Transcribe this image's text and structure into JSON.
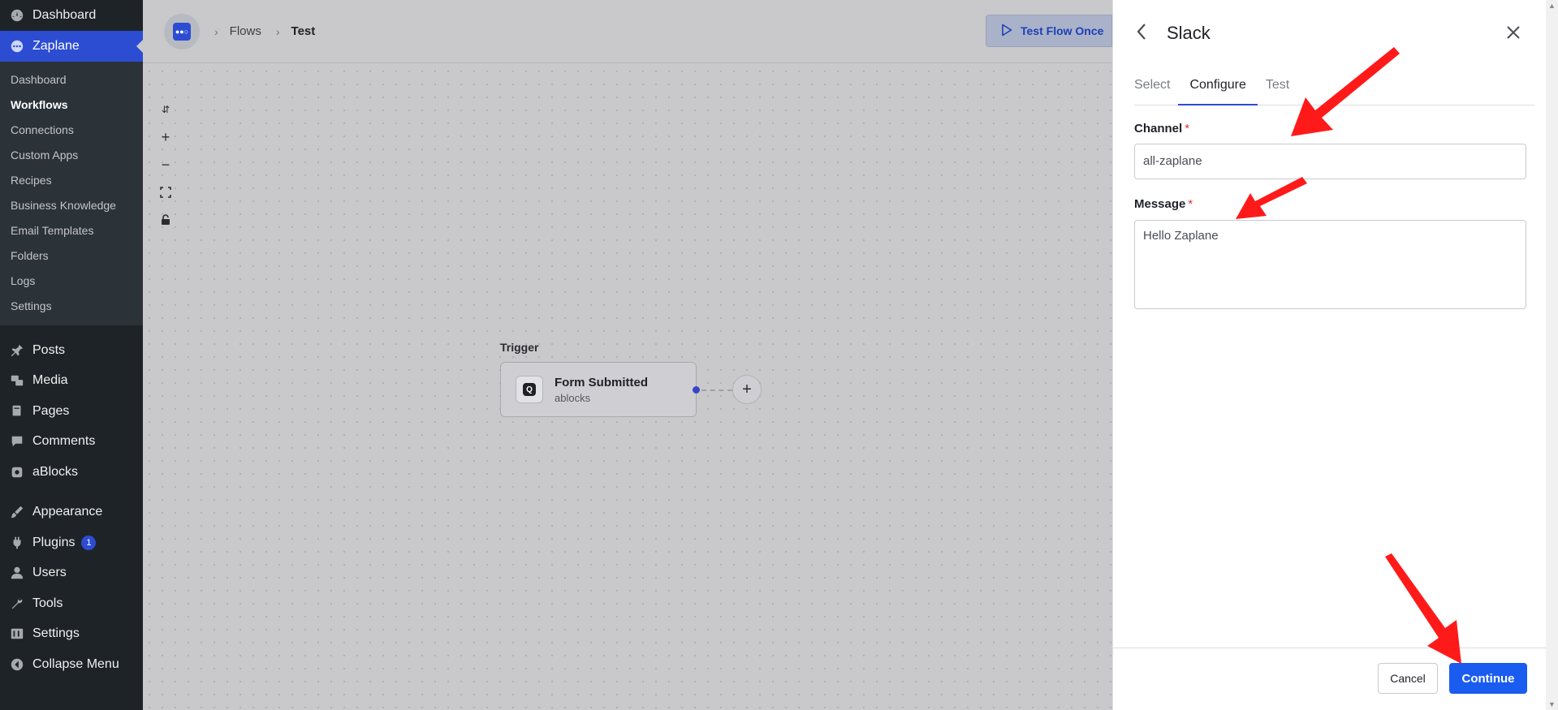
{
  "wp_sidebar": {
    "top_item": "Dashboard",
    "active_item": "Zaplane",
    "submenu": [
      "Dashboard",
      "Workflows",
      "Connections",
      "Custom Apps",
      "Recipes",
      "Business Knowledge",
      "Email Templates",
      "Folders",
      "Logs",
      "Settings"
    ],
    "current_submenu": "Workflows",
    "group1": [
      {
        "label": "Posts",
        "icon": "pin-icon"
      },
      {
        "label": "Media",
        "icon": "media-icon"
      },
      {
        "label": "Pages",
        "icon": "pages-icon"
      },
      {
        "label": "Comments",
        "icon": "comments-icon"
      },
      {
        "label": "aBlocks",
        "icon": "ablocks-icon"
      }
    ],
    "group2": [
      {
        "label": "Appearance",
        "icon": "brush-icon"
      },
      {
        "label": "Plugins",
        "icon": "plugin-icon",
        "badge": "1"
      },
      {
        "label": "Users",
        "icon": "user-icon"
      },
      {
        "label": "Tools",
        "icon": "wrench-icon"
      },
      {
        "label": "Settings",
        "icon": "settings-icon"
      },
      {
        "label": "Collapse Menu",
        "icon": "collapse-icon"
      }
    ]
  },
  "topbar": {
    "breadcrumb": [
      "Flows",
      "Test"
    ],
    "test_button": "Test Flow Once"
  },
  "canvas": {
    "trigger_label": "Trigger",
    "node_title": "Form Submitted",
    "node_subtitle": "ablocks"
  },
  "panel": {
    "title": "Slack",
    "tabs": [
      "Select",
      "Configure",
      "Test"
    ],
    "active_tab": "Configure",
    "channel_label": "Channel",
    "channel_value": "all-zaplane",
    "message_label": "Message",
    "message_value": "Hello Zaplane",
    "required_mark": "*",
    "cancel": "Cancel",
    "continue": "Continue"
  },
  "colors": {
    "accent": "#2c4dd2",
    "primary_button": "#1a5cf0",
    "annotation_arrow": "#ff1a1a"
  }
}
